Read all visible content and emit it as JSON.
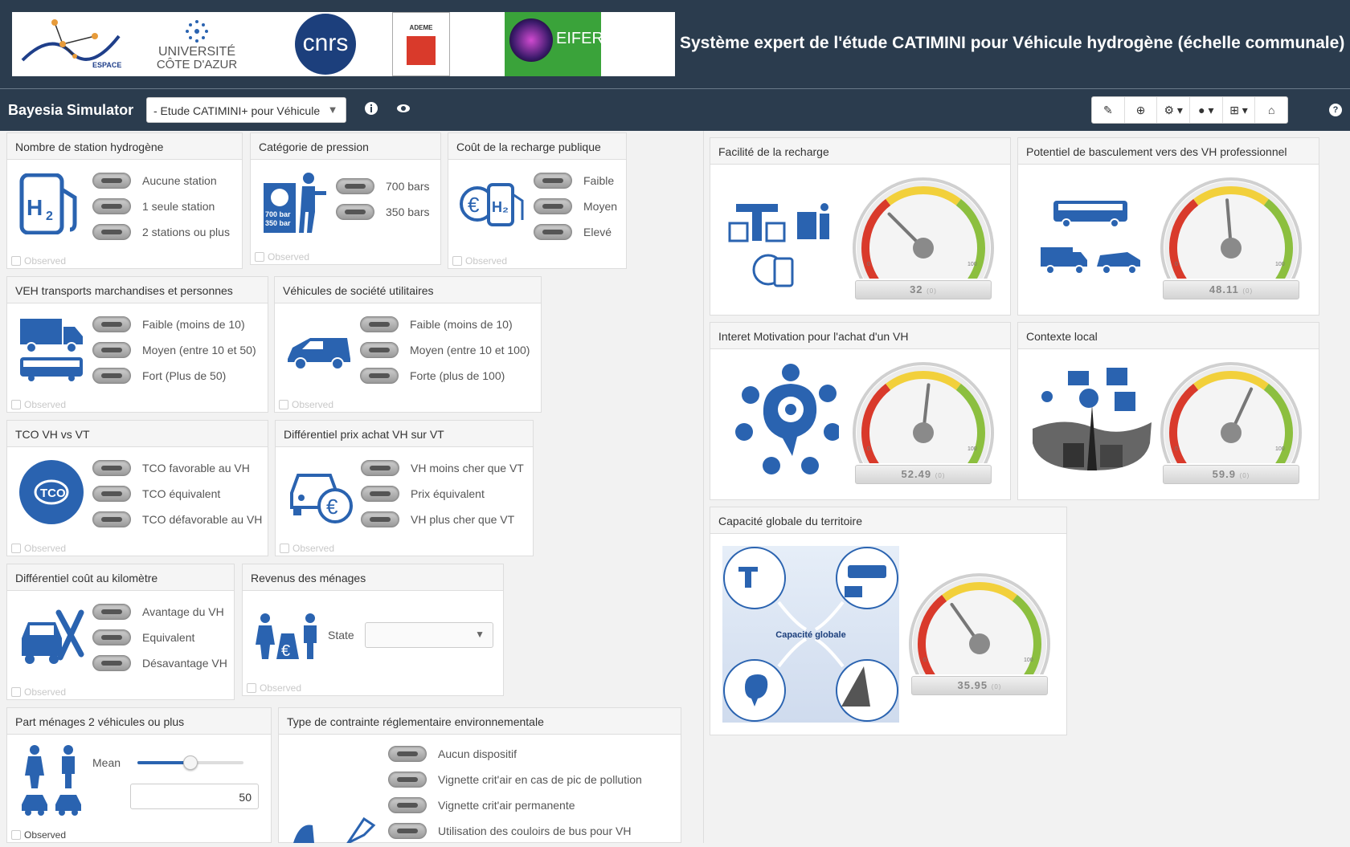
{
  "banner": {
    "logos": [
      "ESPACE",
      "UNIVERSITÉ",
      "CÔTE D'AZUR",
      "cnrs",
      "ADEME",
      "EIFER"
    ],
    "title": "Système expert de l'étude CATIMINI pour Véhicule hydrogène (échelle communale)"
  },
  "toolbar": {
    "app_title": "Bayesia Simulator",
    "model_select": "- Etude CATIMINI+ pour Véhicule",
    "icons": [
      "info-icon",
      "eye-icon",
      "eraser-icon",
      "add-icon",
      "gear-icon",
      "user-icon",
      "hierarchy-icon",
      "home-icon",
      "help-icon"
    ]
  },
  "observed_label": "Observed",
  "panels": {
    "stations": {
      "title": "Nombre de station hydrogène",
      "options": [
        "Aucune station",
        "1 seule station",
        "2 stations ou plus"
      ]
    },
    "pression": {
      "title": "Catégorie de pression",
      "options": [
        "700 bars",
        "350 bars"
      ],
      "icon_text": [
        "700 bar",
        "350 bar"
      ]
    },
    "cout_recharge": {
      "title": "Coût de la recharge publique",
      "options": [
        "Faible",
        "Moyen",
        "Elevé"
      ]
    },
    "veh_transports": {
      "title": "VEH transports marchandises et personnes",
      "options": [
        "Faible (moins de 10)",
        "Moyen (entre 10 et 50)",
        "Fort (Plus de 50)"
      ]
    },
    "vehicules_societe": {
      "title": "Véhicules de société utilitaires",
      "options": [
        "Faible (moins de 10)",
        "Moyen (entre 10 et 100)",
        "Forte (plus de 100)"
      ]
    },
    "tco": {
      "title": "TCO VH vs VT",
      "options": [
        "TCO favorable au VH",
        "TCO équivalent",
        "TCO défavorable au VH"
      ],
      "icon_text": "TCO"
    },
    "differentiel_prix": {
      "title": "Différentiel prix achat VH sur VT",
      "options": [
        "VH moins cher que VT",
        "Prix équivalent",
        "VH plus cher que VT"
      ]
    },
    "differentiel_km": {
      "title": "Différentiel coût au kilomètre",
      "options": [
        "Avantage du VH",
        "Equivalent",
        "Désavantage VH"
      ]
    },
    "revenus": {
      "title": "Revenus des ménages",
      "state_label": "State",
      "state_value": ""
    },
    "part_menages": {
      "title": "Part ménages 2 véhicules ou plus",
      "mean_label": "Mean",
      "mean_value": "50",
      "slider_fraction": 0.5
    },
    "contrainte": {
      "title": "Type de contrainte réglementaire environnementale",
      "options": [
        "Aucun dispositif",
        "Vignette crit'air en cas de pic de pollution",
        "Vignette crit'air permanente",
        "Utilisation des couloirs de bus pour VH"
      ]
    }
  },
  "gauges": {
    "facilite": {
      "title": "Facilité de la recharge",
      "value": 32,
      "label": "32",
      "min": "0",
      "max": "100",
      "sub": "(0)"
    },
    "potentiel": {
      "title": "Potentiel de basculement vers des VH professionnel",
      "value": 48.11,
      "label": "48.11",
      "min": "0",
      "max": "100",
      "sub": "(0)"
    },
    "interet": {
      "title": "Interet Motivation pour l'achat d'un VH",
      "value": 52.49,
      "label": "52.49",
      "min": "0",
      "max": "100",
      "sub": "(0)"
    },
    "contexte": {
      "title": "Contexte local",
      "value": 59.9,
      "label": "59.9",
      "min": "0",
      "max": "100",
      "sub": "(0)"
    },
    "capacite": {
      "title": "Capacité globale du territoire",
      "value": 35.95,
      "label": "35.95",
      "min": "0",
      "max": "100",
      "sub": "(0)",
      "diagram_label": "Capacité globale"
    }
  },
  "colors": {
    "banner": "#2b3c4e",
    "icon_blue": "#2a63b0",
    "gauge_red": "#d93a2b",
    "gauge_yellow": "#f2d03b",
    "gauge_green": "#8cbf3f"
  }
}
